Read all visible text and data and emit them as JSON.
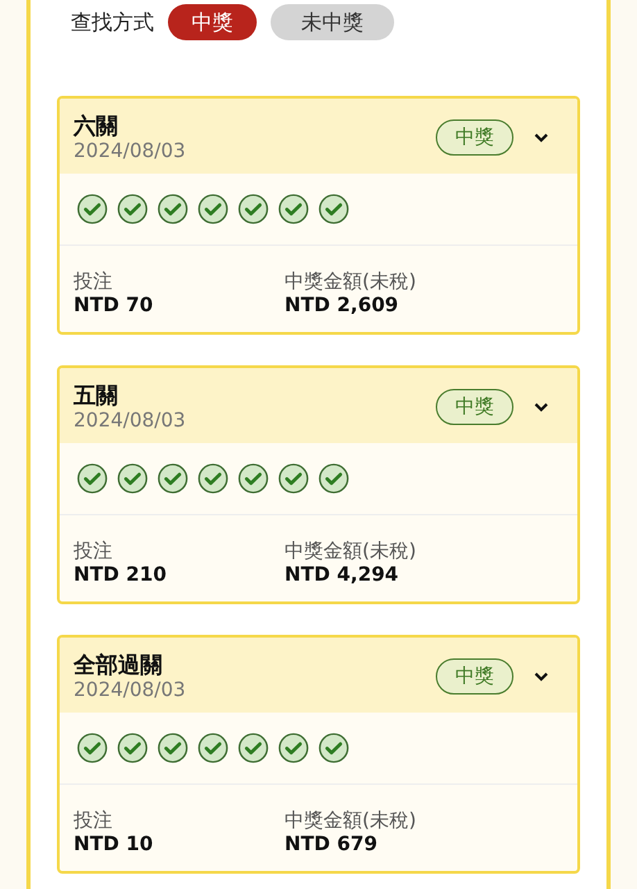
{
  "filter": {
    "label": "查找方式",
    "options": [
      {
        "label": "中獎",
        "selected": true
      },
      {
        "label": "未中獎",
        "selected": false
      }
    ]
  },
  "tickets": [
    {
      "title": "六關",
      "date": "2024/08/03",
      "badge": "中獎",
      "picks": [
        {
          "checked": true
        },
        {
          "checked": true
        },
        {
          "checked": true
        },
        {
          "checked": true
        },
        {
          "checked": true
        },
        {
          "checked": true
        },
        {
          "checked": true
        }
      ],
      "stake_label": "投注",
      "stake": "NTD 70",
      "prize_label": "中獎金額(未稅)",
      "prize": "NTD 2,609"
    },
    {
      "title": "五關",
      "date": "2024/08/03",
      "badge": "中獎",
      "picks": [
        {
          "checked": true
        },
        {
          "checked": true
        },
        {
          "checked": true
        },
        {
          "checked": true
        },
        {
          "checked": true
        },
        {
          "checked": true
        },
        {
          "checked": true
        }
      ],
      "stake_label": "投注",
      "stake": "NTD 210",
      "prize_label": "中獎金額(未稅)",
      "prize": "NTD 4,294"
    },
    {
      "title": "全部過關",
      "date": "2024/08/03",
      "badge": "中獎",
      "picks": [
        {
          "checked": true
        },
        {
          "checked": true
        },
        {
          "checked": true
        },
        {
          "checked": true
        },
        {
          "checked": true
        },
        {
          "checked": true
        },
        {
          "checked": true
        }
      ],
      "stake_label": "投注",
      "stake": "NTD 10",
      "prize_label": "中獎金額(未稅)",
      "prize": "NTD 679"
    }
  ]
}
